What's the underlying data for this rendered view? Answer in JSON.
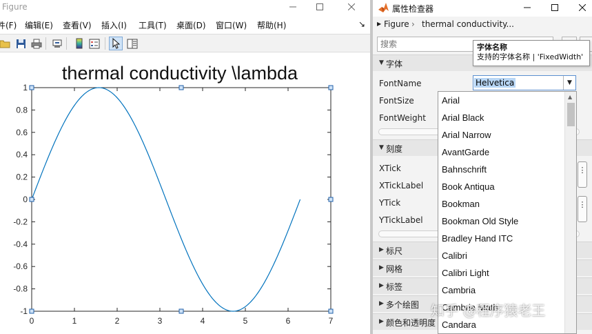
{
  "figure": {
    "window_title": "Figure",
    "menu": [
      {
        "label": "件(F)"
      },
      {
        "label": "编辑(E)"
      },
      {
        "label": "查看(V)"
      },
      {
        "label": "插入(I)"
      },
      {
        "label": "工具(T)"
      },
      {
        "label": "桌面(D)"
      },
      {
        "label": "窗口(W)"
      },
      {
        "label": "帮助(H)"
      }
    ],
    "menu_overflow": "↘",
    "toolbar_icons": [
      "folder-open-icon",
      "save-icon",
      "print-icon",
      "link-plot-icon",
      "colorbar-icon",
      "legend-icon",
      "edit-plot-cursor-icon",
      "property-inspector-icon"
    ]
  },
  "chart_data": {
    "type": "line",
    "title": "thermal conductivity \\lambda",
    "xlabel": "",
    "ylabel": "",
    "xlim": [
      0,
      7
    ],
    "ylim": [
      -1,
      1
    ],
    "xticks": [
      "0",
      "1",
      "2",
      "3",
      "4",
      "5",
      "6",
      "7"
    ],
    "yticks": [
      "1",
      "0.8",
      "0.6",
      "0.4",
      "0.2",
      "0",
      "-0.2",
      "-0.4",
      "-0.6",
      "-0.8",
      "-1"
    ],
    "function": "y = sin(x)",
    "x_range": [
      0,
      6.2832
    ],
    "line_color": "#0072BD",
    "grid": false
  },
  "inspector": {
    "window_title": "属性检查器",
    "breadcrumb": {
      "root": "Figure",
      "current": "thermal conductivity..."
    },
    "search_placeholder": "搜索",
    "sections": {
      "font": "字体",
      "ticks": "刻度",
      "rulers": "标尺",
      "grid": "网格",
      "labels": "标签",
      "multiple_plots": "多个绘图",
      "color_transparency": "颜色和透明度"
    },
    "font_props": {
      "fontname": "FontName",
      "fontsize": "FontSize",
      "fontweight": "FontWeight"
    },
    "tick_props": {
      "xtick": "XTick",
      "xticklabel": "XTickLabel",
      "ytick": "YTick",
      "yticklabel": "YTickLabel"
    },
    "ellipsis": "⋮",
    "fontname_value": "Helvetica",
    "tooltip": {
      "title": "字体名称",
      "body": "支持的字体名称 | 'FixedWidth'"
    },
    "font_options": [
      "Arial",
      "Arial Black",
      "Arial Narrow",
      "AvantGarde",
      "Bahnschrift",
      "Book Antiqua",
      "Bookman",
      "Bookman Old Style",
      "Bradley Hand ITC",
      "Calibri",
      "Calibri Light",
      "Cambria",
      "Cambria Math",
      "Candara"
    ]
  },
  "watermark": "知乎 @程序猿老王",
  "colors": {
    "matlab_logo_orange": "#e5702a",
    "selection_blue": "#b8d6f5"
  }
}
